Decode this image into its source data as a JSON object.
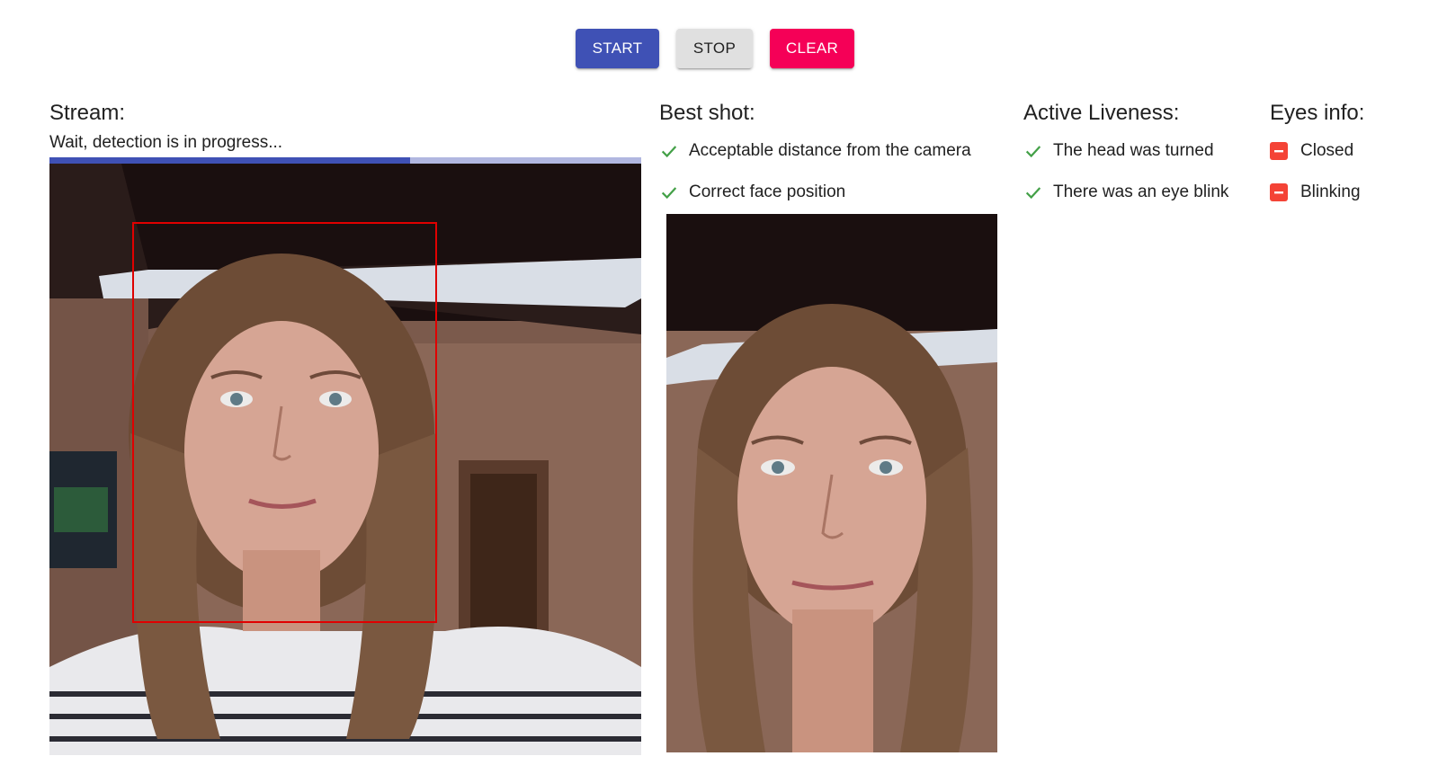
{
  "toolbar": {
    "start_label": "START",
    "stop_label": "STOP",
    "clear_label": "CLEAR"
  },
  "stream": {
    "title": "Stream:",
    "status": "Wait, detection is in progress...",
    "progress": 0.61
  },
  "best_shot": {
    "title": "Best shot:",
    "checks": [
      {
        "label": "Acceptable distance from the camera",
        "icon": "check-icon"
      },
      {
        "label": "Correct face position",
        "icon": "check-icon"
      }
    ]
  },
  "liveness": {
    "title": "Active Liveness:",
    "checks": [
      {
        "label": "The head was turned",
        "icon": "check-icon"
      },
      {
        "label": "There was an eye blink",
        "icon": "check-icon"
      }
    ]
  },
  "eyes": {
    "title": "Eyes info:",
    "items": [
      {
        "label": "Closed",
        "icon": "minus-box-icon"
      },
      {
        "label": "Blinking",
        "icon": "minus-box-icon"
      }
    ]
  },
  "colors": {
    "primary": "#3f51b5",
    "secondary": "#f50057",
    "success": "#43a047",
    "error": "#f44336",
    "face_box": "#e00000"
  }
}
